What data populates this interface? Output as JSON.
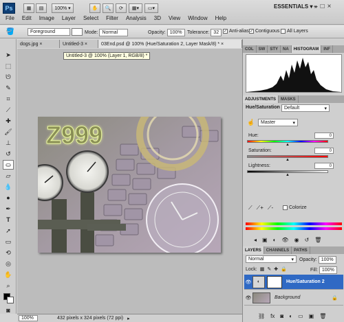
{
  "app": {
    "logo": "Ps",
    "workspace": "ESSENTIALS"
  },
  "appbar": {
    "zoom": "100%",
    "window_controls": [
      "–",
      "□",
      "×"
    ]
  },
  "menu": [
    "File",
    "Edit",
    "Image",
    "Layer",
    "Select",
    "Filter",
    "Analysis",
    "3D",
    "View",
    "Window",
    "Help"
  ],
  "options": {
    "fill_type": "Foreground",
    "mode_label": "Mode:",
    "mode_value": "Normal",
    "opacity_label": "Opacity:",
    "opacity_value": "100%",
    "tolerance_label": "Tolerance:",
    "tolerance_value": "32",
    "anti_alias": "Anti-alias",
    "contiguous": "Contiguous",
    "all_layers": "All Layers"
  },
  "doc_tabs": [
    "dogs.jpg",
    "Untitled-3",
    "03End.psd @ 100% (Hue/Saturation 2, Layer Mask/8) *"
  ],
  "tooltip": "Untitled-3 @ 100% (Layer 1, RGB/8) *",
  "canvas": {
    "text": "Z999"
  },
  "status": {
    "zoom": "100%",
    "doc_info": "432 pixels x 324 pixels (72 ppi)"
  },
  "panels": {
    "histogram_tabs": [
      "COL",
      "SW",
      "STY",
      "NA",
      "HISTOGRAM",
      "INF"
    ],
    "adjust_tabs": [
      "ADJUSTMENTS",
      "MASKS"
    ],
    "adjustment_name": "Hue/Saturation",
    "preset": "Default",
    "channel": "Master",
    "hue_label": "Hue:",
    "hue_value": "0",
    "saturation_label": "Saturation:",
    "saturation_value": "0",
    "lightness_label": "Lightness:",
    "lightness_value": "0",
    "colorize_label": "Colorize",
    "layers_tabs": [
      "LAYERS",
      "CHANNELS",
      "PATHS"
    ],
    "blend_mode": "Normal",
    "opacity_label": "Opacity:",
    "opacity_value": "100%",
    "lock_label": "Lock:",
    "fill_label": "Fill:",
    "fill_value": "100%",
    "layers": [
      {
        "name": "Hue/Saturation 2",
        "selected": true
      },
      {
        "name": "Background",
        "selected": false
      }
    ]
  },
  "colors": {
    "selection": "#2f69c4",
    "photoshop_blue": "#0f3f75"
  }
}
